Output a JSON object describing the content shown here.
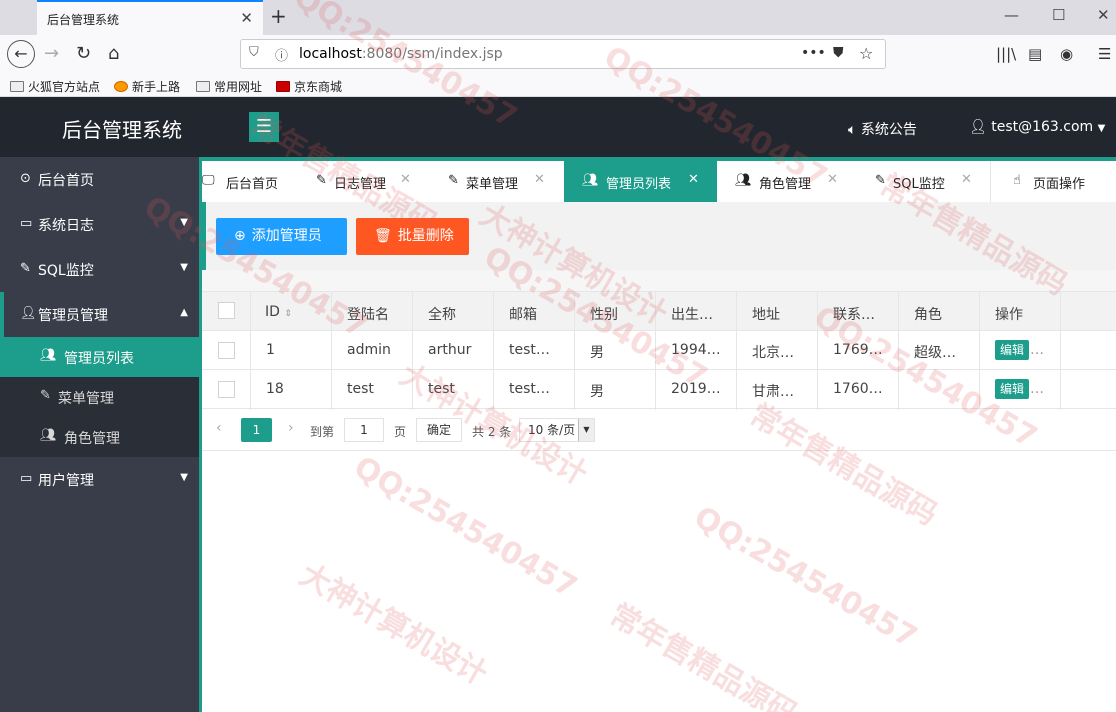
{
  "browser": {
    "tab_title": "后台管理系统",
    "url_host": "localhost",
    "url_rest": ":8080/ssm/index.jsp",
    "bookmarks": [
      "火狐官方站点",
      "新手上路",
      "常用网址",
      "京东商城"
    ]
  },
  "header": {
    "title": "后台管理系统",
    "notice": "系统公告",
    "user": "test@163.com"
  },
  "sidebar": {
    "items": [
      {
        "label": "后台首页"
      },
      {
        "label": "系统日志"
      },
      {
        "label": "SQL监控"
      },
      {
        "label": "管理员管理"
      },
      {
        "label": "用户管理"
      }
    ],
    "subitems": [
      {
        "label": "管理员列表"
      },
      {
        "label": "菜单管理"
      },
      {
        "label": "角色管理"
      }
    ]
  },
  "tabs": [
    {
      "label": "后台首页"
    },
    {
      "label": "日志管理"
    },
    {
      "label": "菜单管理"
    },
    {
      "label": "管理员列表"
    },
    {
      "label": "角色管理"
    },
    {
      "label": "SQL监控"
    },
    {
      "label": "页面操作"
    }
  ],
  "toolbar": {
    "add_label": "添加管理员",
    "batch_delete_label": "批量删除"
  },
  "table": {
    "columns": [
      "ID",
      "登陆名",
      "全称",
      "邮箱",
      "性别",
      "出生…",
      "地址",
      "联系…",
      "角色",
      "操作"
    ],
    "rows": [
      {
        "id": "1",
        "login": "admin",
        "fullname": "arthur",
        "email": "test…",
        "gender": "男",
        "birth": "1994…",
        "address": "北京…",
        "phone": "1769…",
        "role": "超级…",
        "action": "编辑"
      },
      {
        "id": "18",
        "login": "test",
        "fullname": "test",
        "email": "test…",
        "gender": "男",
        "birth": "2019…",
        "address": "甘肃…",
        "phone": "1760…",
        "role": "",
        "action": "编辑"
      }
    ]
  },
  "pager": {
    "current": "1",
    "goto_label": "到第",
    "page_input": "1",
    "page_unit": "页",
    "confirm": "确定",
    "total": "共 2 条",
    "page_size": "10 条/页"
  },
  "watermarks": [
    "QQ:254540457",
    "常年售精品源码",
    "大神计算机设计"
  ],
  "colors": {
    "accent": "#1d9d8b",
    "sidebar": "#393d49",
    "header": "#22262e",
    "add": "#1e9fff",
    "delete": "#ff5722"
  }
}
